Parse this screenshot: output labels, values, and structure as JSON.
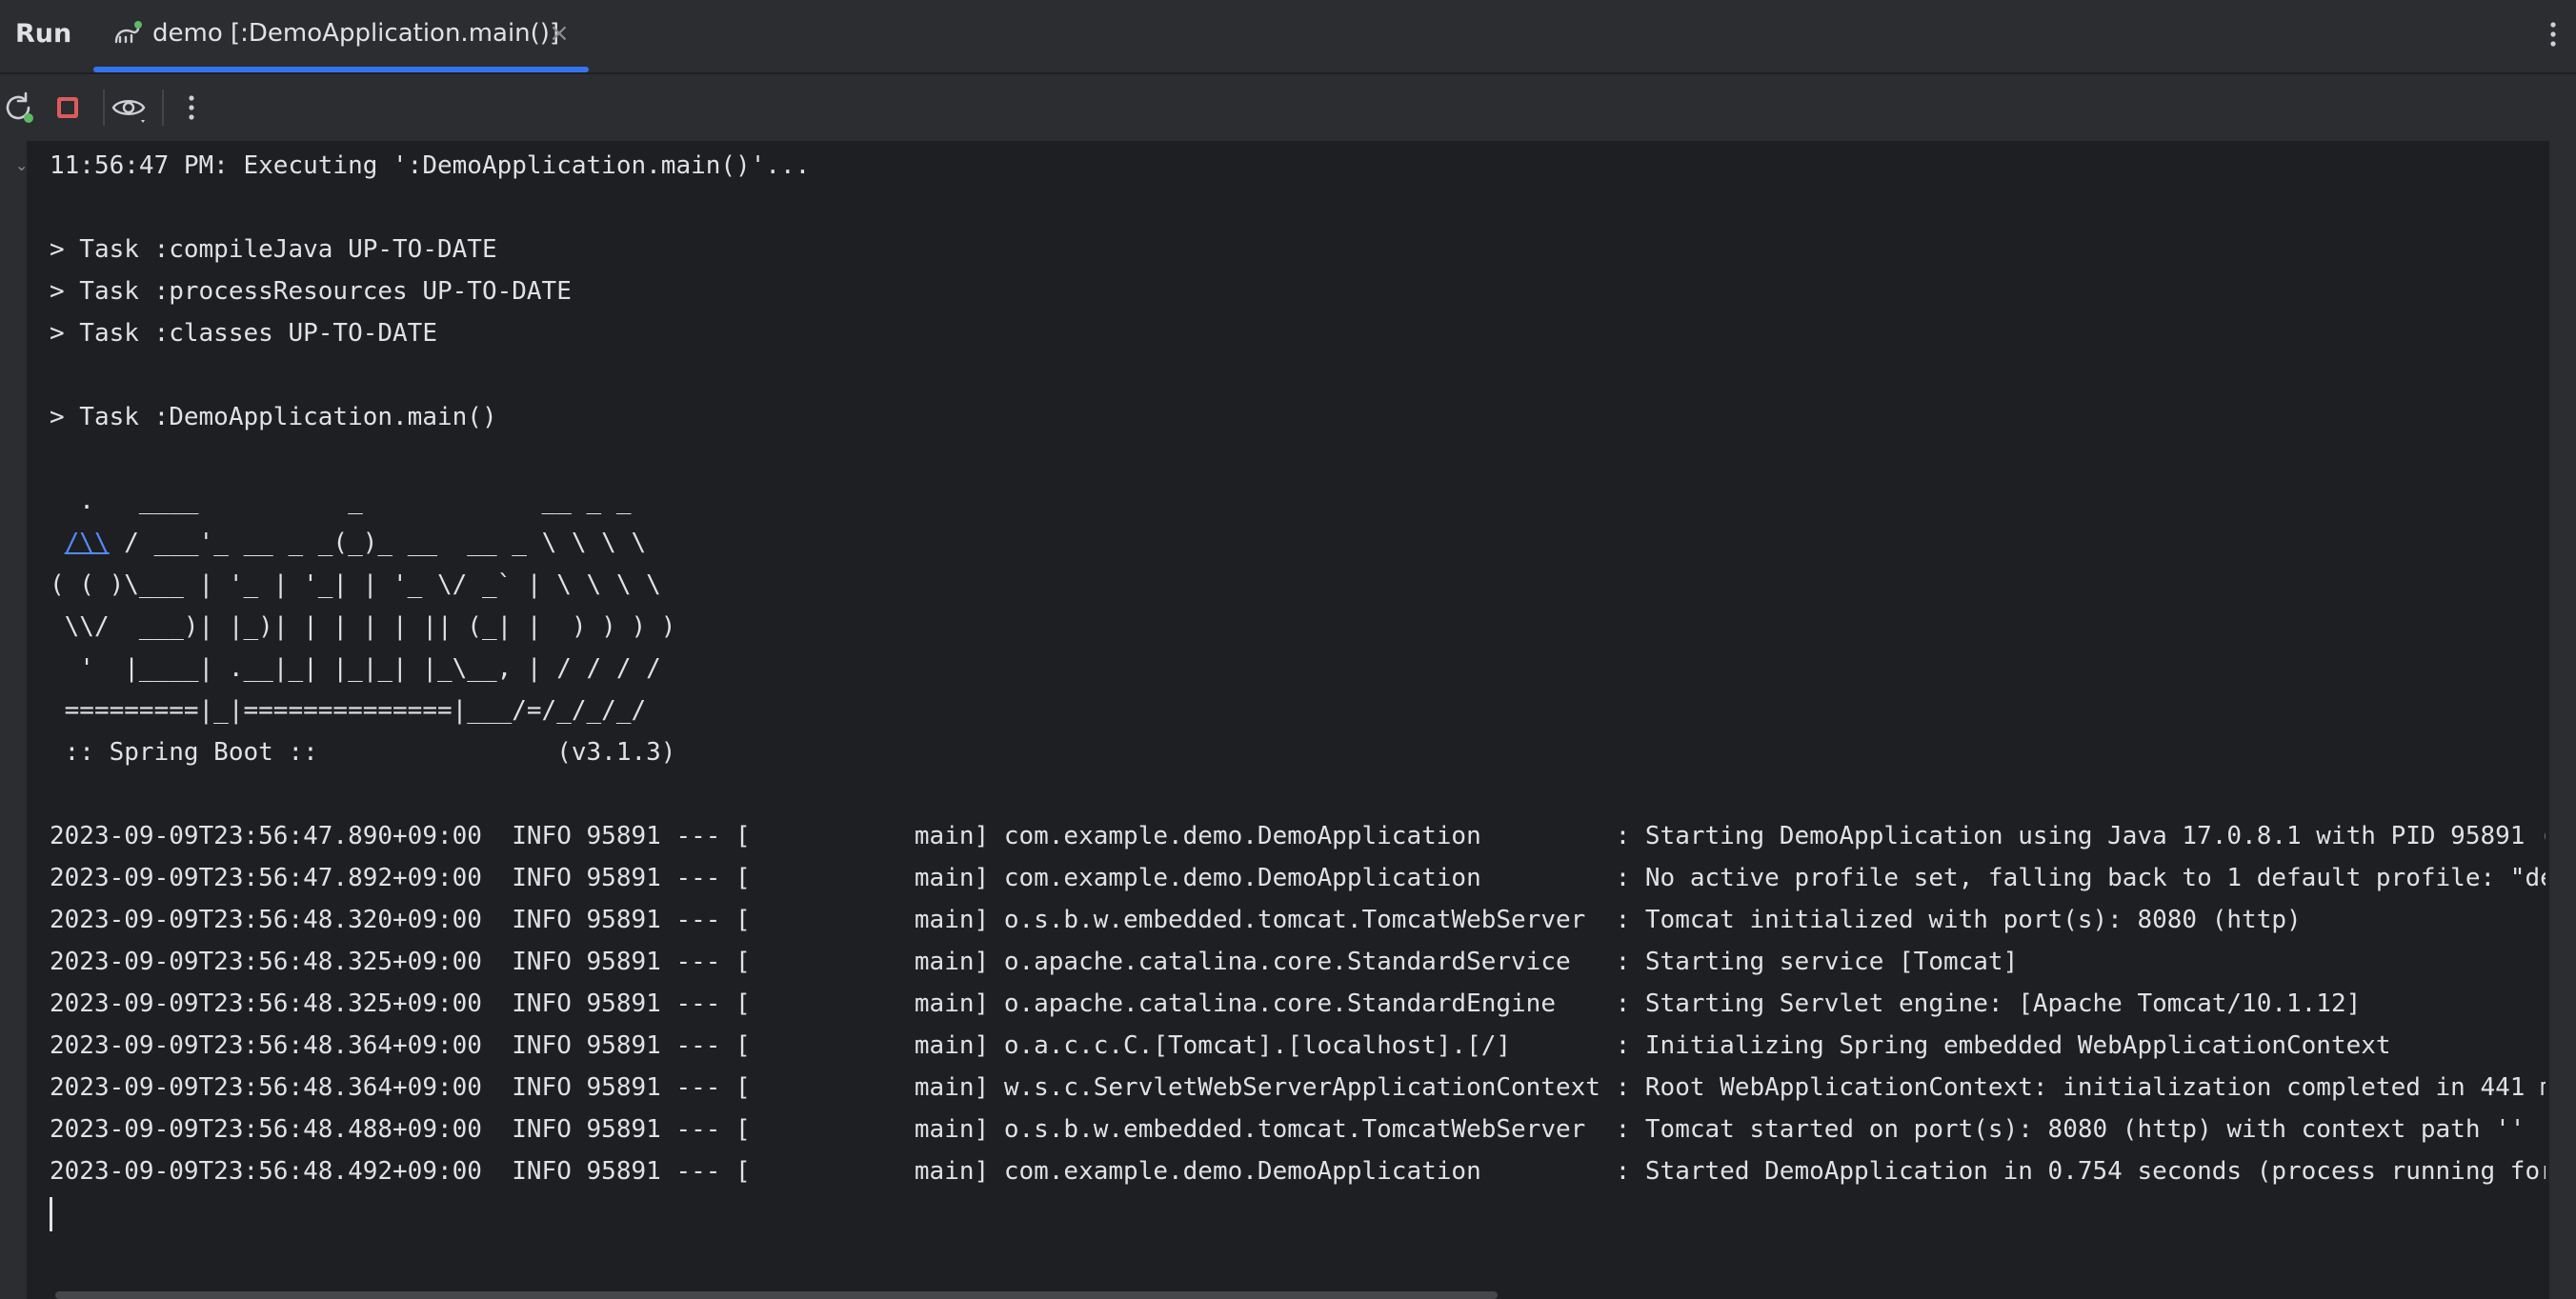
{
  "tabbar": {
    "run_label": "Run",
    "tab_title": "demo [:DemoApplication.main()]",
    "close_glyph": "×"
  },
  "icons": {
    "tab_icon": "gradle-elephant-icon",
    "rerun": "rerun-icon",
    "stop": "stop-icon",
    "view": "eye-view-icon",
    "more": "more-vertical-icon"
  },
  "colors": {
    "accent": "#3574f0",
    "stop": "#db5c5c",
    "link": "#548af7",
    "running_dot": "#5fb865"
  },
  "console": {
    "header_line": "11:56:47 PM: Executing ':DemoApplication.main()'...",
    "tasks": [
      "> Task :compileJava UP-TO-DATE",
      "> Task :processResources UP-TO-DATE",
      "> Task :classes UP-TO-DATE"
    ],
    "main_task": "> Task :DemoApplication.main()",
    "banner": {
      "line1": "  .   ____          _            __ _ _",
      "line2_link": "/\\\\",
      "line2_rest": " / ___'_ __ _ _(_)_ __  __ _ \\ \\ \\ \\",
      "line3": "( ( )\\___ | '_ | '_| | '_ \\/ _` | \\ \\ \\ \\",
      "line4": " \\\\/  ___)| |_)| | | | | || (_| |  ) ) ) )",
      "line5": "  '  |____| .__|_| |_|_| |_\\__, | / / / /",
      "line6": " =========|_|==============|___/=/_/_/_/",
      "line7": " :: Spring Boot ::                (v3.1.3)"
    },
    "logs": [
      "2023-09-09T23:56:47.890+09:00  INFO 95891 --- [           main] com.example.demo.DemoApplication         : Starting DemoApplication using Java 17.0.8.1 with PID 95891 (",
      "2023-09-09T23:56:47.892+09:00  INFO 95891 --- [           main] com.example.demo.DemoApplication         : No active profile set, falling back to 1 default profile: \"de",
      "2023-09-09T23:56:48.320+09:00  INFO 95891 --- [           main] o.s.b.w.embedded.tomcat.TomcatWebServer  : Tomcat initialized with port(s): 8080 (http)",
      "2023-09-09T23:56:48.325+09:00  INFO 95891 --- [           main] o.apache.catalina.core.StandardService   : Starting service [Tomcat]",
      "2023-09-09T23:56:48.325+09:00  INFO 95891 --- [           main] o.apache.catalina.core.StandardEngine    : Starting Servlet engine: [Apache Tomcat/10.1.12]",
      "2023-09-09T23:56:48.364+09:00  INFO 95891 --- [           main] o.a.c.c.C.[Tomcat].[localhost].[/]       : Initializing Spring embedded WebApplicationContext",
      "2023-09-09T23:56:48.364+09:00  INFO 95891 --- [           main] w.s.c.ServletWebServerApplicationContext : Root WebApplicationContext: initialization completed in 441 m",
      "2023-09-09T23:56:48.488+09:00  INFO 95891 --- [           main] o.s.b.w.embedded.tomcat.TomcatWebServer  : Tomcat started on port(s): 8080 (http) with context path ''",
      "2023-09-09T23:56:48.492+09:00  INFO 95891 --- [           main] com.example.demo.DemoApplication         : Started DemoApplication in 0.754 seconds (process running for"
    ]
  }
}
